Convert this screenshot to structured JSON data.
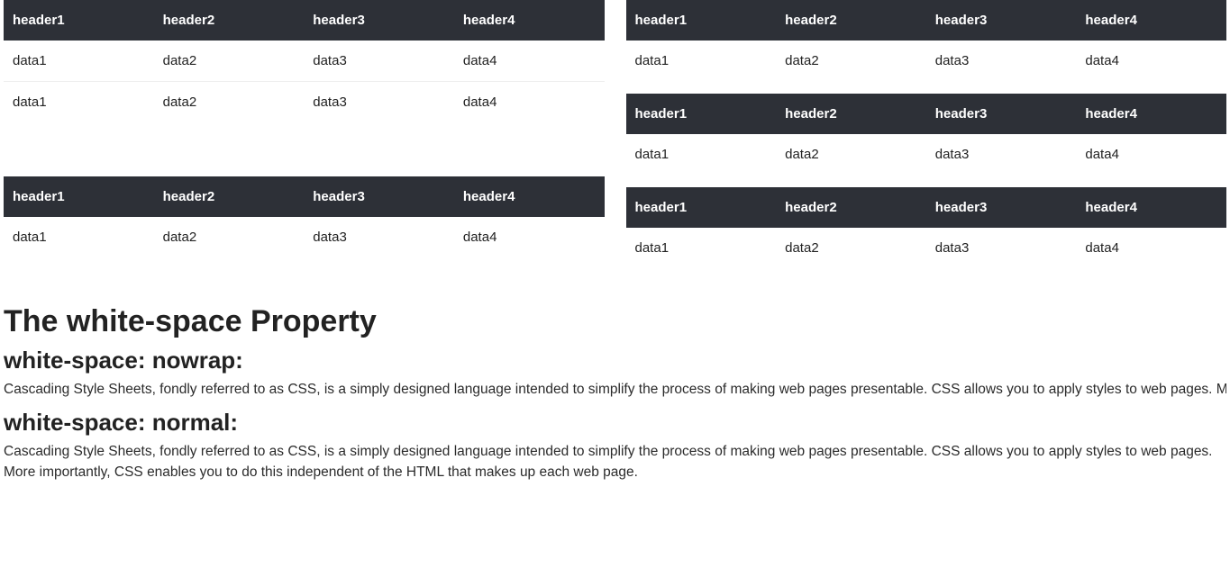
{
  "tables": {
    "headers": [
      "header1",
      "header2",
      "header3",
      "header4"
    ],
    "row": [
      "data1",
      "data2",
      "data3",
      "data4"
    ]
  },
  "article": {
    "title": "The white-space Property",
    "section1_heading": "white-space: nowrap:",
    "section1_text": "Cascading Style Sheets, fondly referred to as CSS, is a simply designed language intended to simplify the process of making web pages presentable. CSS allows you to apply styles to web pages. More importantly, CSS enables you to do this independent of the HTML that makes up each web page.",
    "section2_heading": "white-space: normal:",
    "section2_text": "Cascading Style Sheets, fondly referred to as CSS, is a simply designed language intended to simplify the process of making web pages presentable. CSS allows you to apply styles to web pages. More importantly, CSS enables you to do this independent of the HTML that makes up each web page."
  }
}
